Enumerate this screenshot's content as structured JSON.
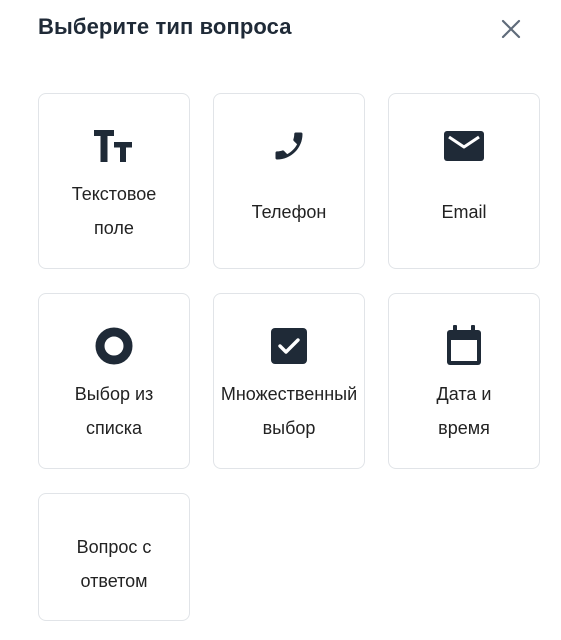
{
  "dialog": {
    "title": "Выберите тип вопроса"
  },
  "icons": {
    "close": "close-icon",
    "text": "text-format-icon",
    "phone": "phone-icon",
    "email": "email-icon",
    "choice": "radio-circle-icon",
    "multi": "checkbox-icon",
    "datetime": "calendar-icon"
  },
  "colors": {
    "icon": "#1f2a37",
    "border": "#e1e4e8",
    "close": "#5f6b7a"
  },
  "options": [
    {
      "line1": "Текстовое",
      "line2": "поле"
    },
    {
      "line1": "Телефон"
    },
    {
      "line1": "Email"
    },
    {
      "line1": "Выбор из",
      "line2": "списка"
    },
    {
      "line1": "Множественный",
      "line2": "выбор"
    },
    {
      "line1": "Дата и",
      "line2": "время"
    },
    {
      "line1": "Вопрос с",
      "line2": "ответом"
    }
  ]
}
